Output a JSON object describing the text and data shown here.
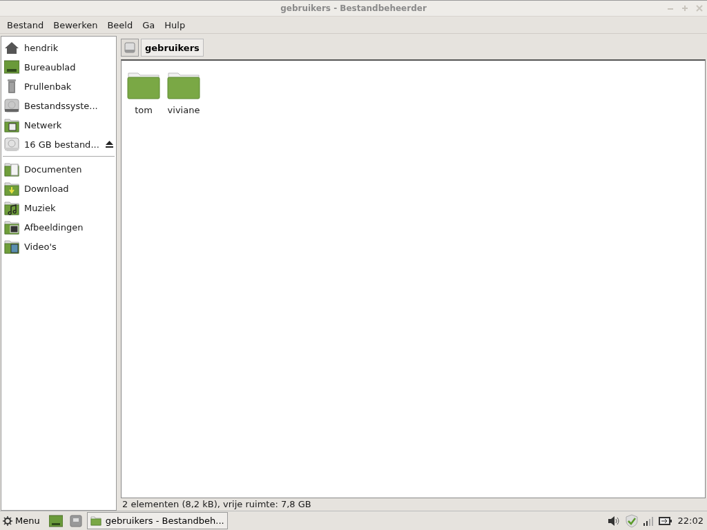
{
  "window": {
    "title": "gebruikers - Bestandbeheerder"
  },
  "menu": [
    "Bestand",
    "Bewerken",
    "Beeld",
    "Ga",
    "Hulp"
  ],
  "sidebar": {
    "places": [
      {
        "label": "hendrik",
        "kind": "home"
      },
      {
        "label": "Bureaublad",
        "kind": "desktop"
      },
      {
        "label": "Prullenbak",
        "kind": "trash"
      },
      {
        "label": "Bestandssyste...",
        "kind": "drive"
      },
      {
        "label": "Netwerk",
        "kind": "network"
      },
      {
        "label": "16 GB bestand...",
        "kind": "removable"
      }
    ],
    "bookmarks": [
      {
        "label": "Documenten",
        "kind": "documents"
      },
      {
        "label": "Download",
        "kind": "download"
      },
      {
        "label": "Muziek",
        "kind": "music"
      },
      {
        "label": "Afbeeldingen",
        "kind": "pictures"
      },
      {
        "label": "Video's",
        "kind": "videos"
      }
    ]
  },
  "path_bar": {
    "current": "gebruikers"
  },
  "files": [
    {
      "name": "tom"
    },
    {
      "name": "viviane"
    }
  ],
  "status_bar": "2 elementen (8,2 kB), vrije ruimte: 7,8 GB",
  "taskbar": {
    "menu": "Menu",
    "task": "gebruikers - Bestandbeh...",
    "clock": "22:02"
  }
}
